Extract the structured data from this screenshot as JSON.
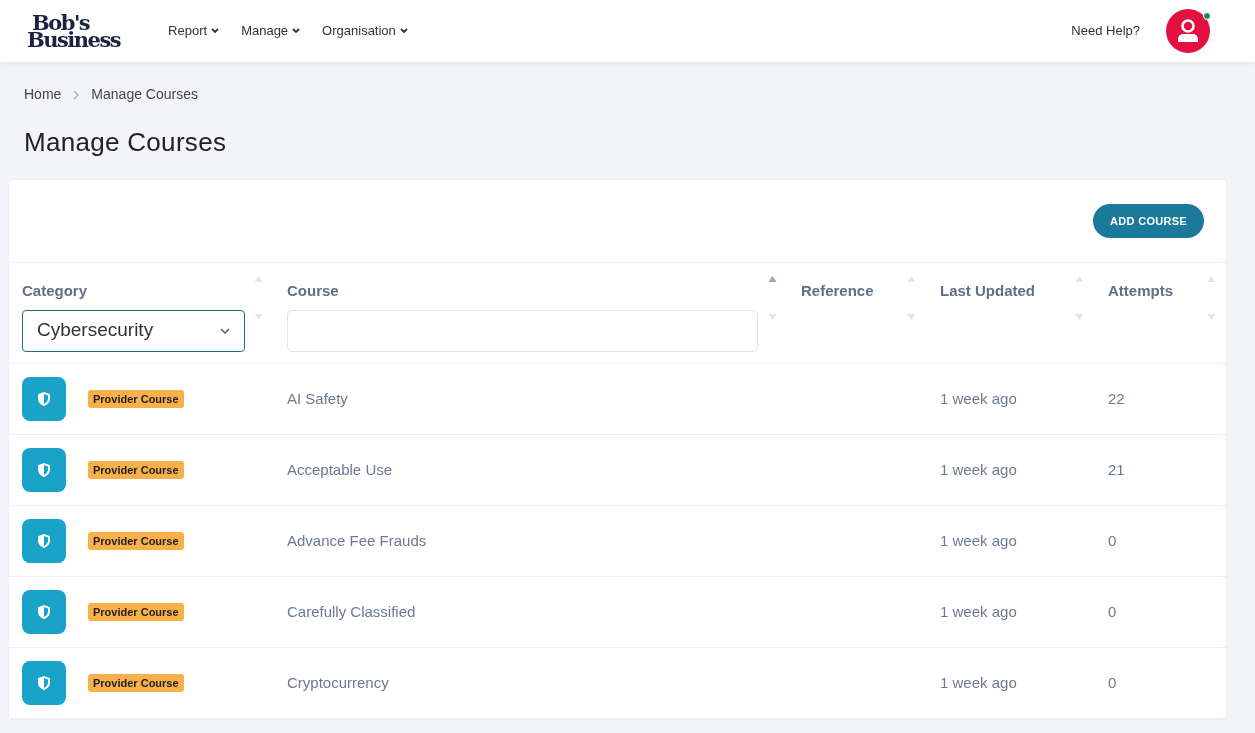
{
  "header": {
    "logo": [
      "Bob's",
      "Business"
    ],
    "nav": [
      {
        "label": "Report"
      },
      {
        "label": "Manage"
      },
      {
        "label": "Organisation"
      }
    ],
    "help": "Need Help?",
    "user_online": true
  },
  "breadcrumb": [
    "Home",
    "Manage Courses"
  ],
  "title": "Manage Courses",
  "add_button": "ADD COURSE",
  "table": {
    "columns": [
      {
        "label": "Category",
        "sorted": false,
        "filter": {
          "kind": "select",
          "value": "Cybersecurity"
        }
      },
      {
        "label": "Course",
        "sorted": true,
        "filter": {
          "kind": "text"
        }
      },
      {
        "label": "Reference",
        "sorted": false
      },
      {
        "label": "Last Updated",
        "sorted": false
      },
      {
        "label": "Attempts",
        "sorted": false
      }
    ],
    "rows": [
      {
        "badge": "Provider Course",
        "course": "AI Safety",
        "updated": "1 week ago",
        "attempts": "22"
      },
      {
        "badge": "Provider Course",
        "course": "Acceptable Use",
        "updated": "1 week ago",
        "attempts": "21"
      },
      {
        "badge": "Provider Course",
        "course": "Advance Fee Frauds",
        "updated": "1 week ago",
        "attempts": "0"
      },
      {
        "badge": "Provider Course",
        "course": "Carefully Classified",
        "updated": "1 week ago",
        "attempts": "0"
      },
      {
        "badge": "Provider Course",
        "course": "Cryptocurrency",
        "updated": "1 week ago",
        "attempts": "0"
      }
    ]
  }
}
